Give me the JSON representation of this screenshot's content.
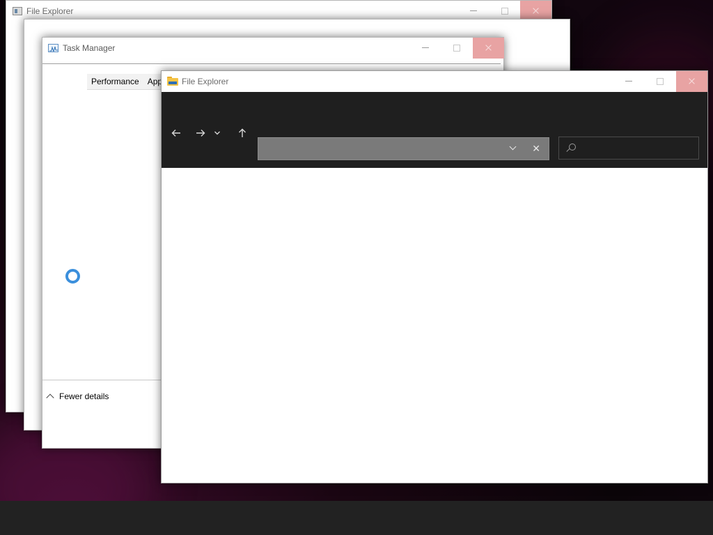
{
  "desktop": {
    "accent_color": "#3a0b2a",
    "taskbar_color": "#222222"
  },
  "windows": {
    "file_explorer_back": {
      "title": "File Explorer"
    },
    "task_manager": {
      "title": "Task Manager",
      "tabs": [
        {
          "label": "Performance"
        },
        {
          "label": "App"
        }
      ],
      "footer": {
        "fewer_details": "Fewer details"
      },
      "loading_spinner_color": "#3b8fdc"
    },
    "file_explorer_front": {
      "title": "File Explorer",
      "nav": {
        "back_icon": "arrow-left-icon",
        "forward_icon": "arrow-right-icon",
        "recent_icon": "chevron-down-icon",
        "up_icon": "arrow-up-icon"
      },
      "address_bar": {
        "value": "",
        "dropdown_icon": "chevron-down-icon",
        "clear_icon": "close-icon"
      },
      "search": {
        "value": "",
        "icon": "search-icon"
      },
      "ribbon_color": "#1f1f1f"
    }
  }
}
